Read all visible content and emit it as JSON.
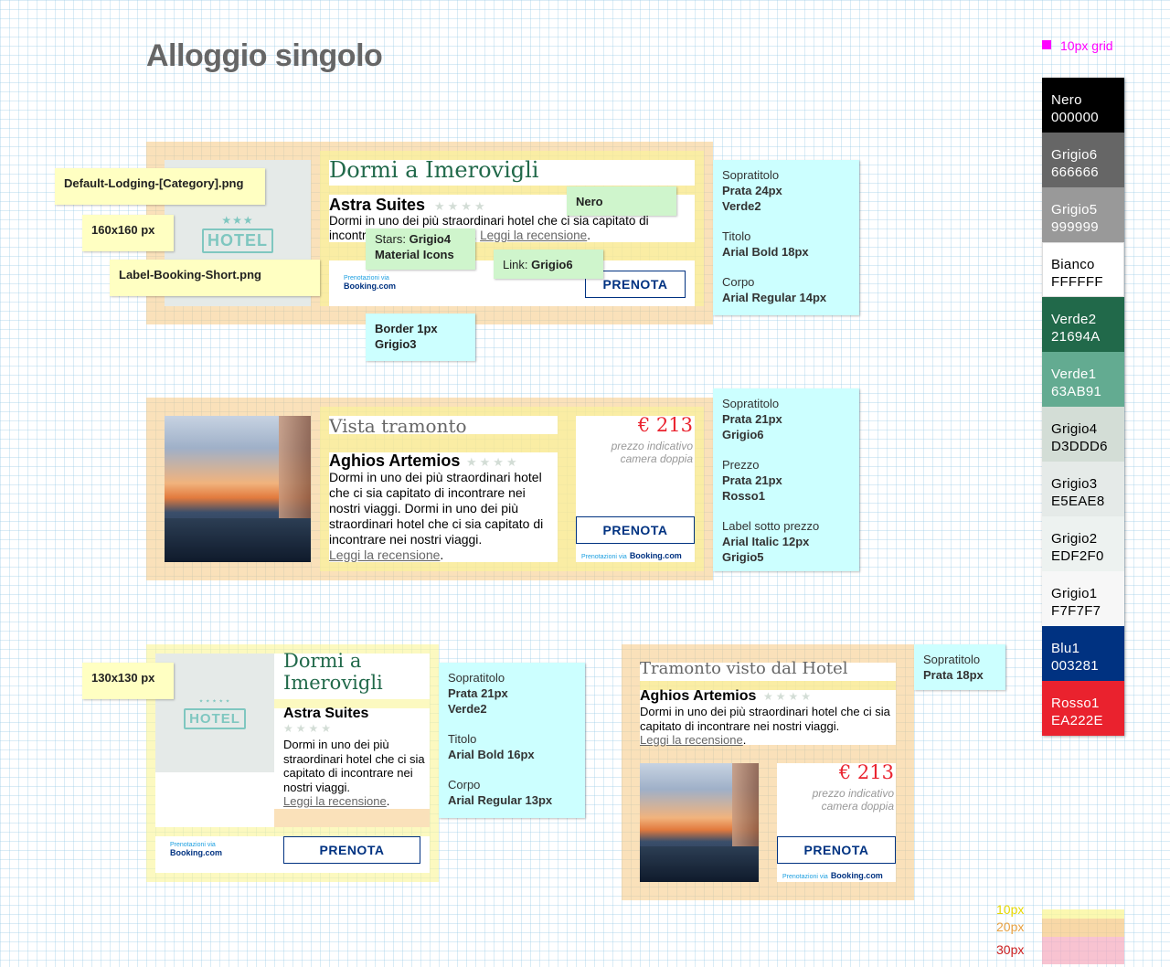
{
  "page": {
    "title": "Alloggio singolo",
    "grid_label": "10px grid"
  },
  "card1": {
    "title": "Dormi a Imerovigli",
    "name": "Astra Suites",
    "stars": "★★★★",
    "body": "Dormi in uno dei più straordinari hotel che ci sia capitato di incontrare nei nostri viaggi.",
    "link": "Leggi la recensione",
    "link_suffix": ".",
    "booking_pre": "Prenotazioni via",
    "booking_logo": "Booking.com",
    "button": "PRENOTA",
    "hotel_sign": "HOTEL",
    "hotel_stars": "★★★"
  },
  "card2": {
    "title": "Vista tramonto",
    "name": "Aghios Artemios",
    "stars": "★★★★",
    "body": "Dormi in uno dei più straordinari hotel che ci sia capitato di incontrare nei nostri viaggi. Dormi in uno dei più straordinari hotel che ci sia capitato di incontrare nei nostri viaggi.",
    "link": "Leggi la recensione",
    "link_suffix": ".",
    "price": "€ 213",
    "price_label": "prezzo indicativo camera doppia",
    "button": "PRENOTA",
    "booking_pre": "Prenotazioni via",
    "booking_logo": "Booking.com"
  },
  "card3": {
    "title": "Dormi a Imerovigli",
    "name": "Astra Suites",
    "stars": "★★★★",
    "body": "Dormi in uno dei più straordinari hotel che ci sia capitato di incontrare nei nostri viaggi.",
    "link": "Leggi la recensione",
    "link_suffix": ".",
    "booking_pre": "Prenotazioni via",
    "booking_logo": "Booking.com",
    "button": "PRENOTA",
    "hotel_sign": "HOTEL"
  },
  "card4": {
    "title": "Tramonto visto dal Hotel",
    "name": "Aghios Artemios",
    "stars": "★★★★",
    "body": "Dormi in uno dei più straordinari hotel che ci sia capitato di incontrare nei nostri viaggi.",
    "link": "Leggi la recensione",
    "link_suffix": ".",
    "price": "€ 213",
    "price_label": "prezzo indicativo camera doppia",
    "button": "PRENOTA",
    "booking_pre": "Prenotazioni via",
    "booking_logo": "Booking.com"
  },
  "notes": {
    "default_lodging": "Default-Lodging-[Category].png",
    "size160": "160x160 px",
    "label_booking": "Label-Booking-Short.png",
    "size130": "130x130 px",
    "nero": "Nero",
    "stars_pre": "Stars:",
    "stars_color": "Grigio4",
    "stars_icons": "Material Icons",
    "link_pre": "Link:",
    "link_color": "Grigio6",
    "border_1": "Border 1px",
    "border_2": "Grigio3"
  },
  "specs": {
    "s1": {
      "a_lab": "Sopratitolo",
      "a_v1": "Prata 24px",
      "a_v2": "Verde2",
      "b_lab": "Titolo",
      "b_v1": "Arial Bold 18px",
      "c_lab": "Corpo",
      "c_v1": "Arial Regular 14px"
    },
    "s2": {
      "a_lab": "Sopratitolo",
      "a_v1": "Prata 21px",
      "a_v2": "Grigio6",
      "b_lab": "Prezzo",
      "b_v1": "Prata 21px",
      "b_v2": "Rosso1",
      "c_lab": "Label sotto prezzo",
      "c_v1": "Arial Italic 12px",
      "c_v2": "Grigio5"
    },
    "s3": {
      "a_lab": "Sopratitolo",
      "a_v1": "Prata 21px",
      "a_v2": "Verde2",
      "b_lab": "Titolo",
      "b_v1": "Arial Bold 16px",
      "c_lab": "Corpo",
      "c_v1": "Arial Regular 13px"
    },
    "s4": {
      "a_lab": "Sopratitolo",
      "a_v1": "Prata 18px"
    }
  },
  "palette": [
    {
      "name": "Nero",
      "hex": "000000",
      "bg": "#000000",
      "fg": "#ffffff"
    },
    {
      "name": "Grigio6",
      "hex": "666666",
      "bg": "#666666",
      "fg": "#ffffff"
    },
    {
      "name": "Grigio5",
      "hex": "999999",
      "bg": "#999999",
      "fg": "#ffffff"
    },
    {
      "name": "Bianco",
      "hex": "FFFFFF",
      "bg": "#FFFFFF",
      "fg": "#000000"
    },
    {
      "name": "Verde2",
      "hex": "21694A",
      "bg": "#21694A",
      "fg": "#ffffff"
    },
    {
      "name": "Verde1",
      "hex": "63AB91",
      "bg": "#63AB91",
      "fg": "#ffffff"
    },
    {
      "name": "Grigio4",
      "hex": "D3DDD6",
      "bg": "#D3DDD6",
      "fg": "#000000"
    },
    {
      "name": "Grigio3",
      "hex": "E5EAE8",
      "bg": "#E5EAE8",
      "fg": "#000000"
    },
    {
      "name": "Grigio2",
      "hex": "EDF2F0",
      "bg": "#EDF2F0",
      "fg": "#000000"
    },
    {
      "name": "Grigio1",
      "hex": "F7F7F7",
      "bg": "#F7F7F7",
      "fg": "#000000"
    },
    {
      "name": "Blu1",
      "hex": "003281",
      "bg": "#003281",
      "fg": "#ffffff"
    },
    {
      "name": "Rosso1",
      "hex": "EA222E",
      "bg": "#EA222E",
      "fg": "#ffffff"
    }
  ],
  "legend": {
    "l10": "10px",
    "l20": "20px",
    "l30": "30px"
  }
}
